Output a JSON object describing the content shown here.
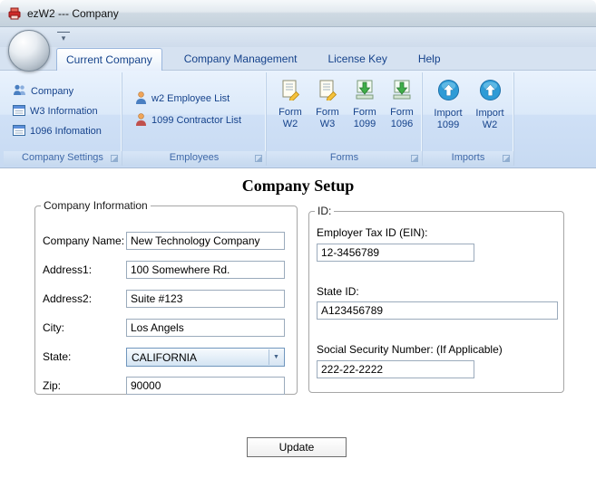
{
  "window": {
    "title": "ezW2 --- Company"
  },
  "icons": {
    "dropdown_arrow": "▾",
    "combo_arrow": "▼"
  },
  "colors": {
    "ribbon_text": "#15428b",
    "group_caption": "#3e68a8",
    "app_red": "#cf2a2a"
  },
  "ribbon": {
    "tabs": [
      {
        "label": "Current Company"
      },
      {
        "label": "Company Management"
      },
      {
        "label": "License Key"
      },
      {
        "label": "Help"
      }
    ],
    "company_settings": {
      "caption": "Company Settings",
      "items": [
        {
          "label": "Company"
        },
        {
          "label": "W3 Information"
        },
        {
          "label": "1096 Infomation"
        }
      ]
    },
    "employees": {
      "caption": "Employees",
      "items": [
        {
          "label": "w2 Employee List"
        },
        {
          "label": "1099 Contractor List"
        }
      ]
    },
    "forms": {
      "caption": "Forms",
      "items": [
        {
          "label": "Form\nW2"
        },
        {
          "label": "Form\nW3"
        },
        {
          "label": "Form\n1099"
        },
        {
          "label": "Form\n1096"
        }
      ]
    },
    "imports": {
      "caption": "Imports",
      "items": [
        {
          "label": "Import\n1099"
        },
        {
          "label": "Import\nW2"
        }
      ]
    }
  },
  "main": {
    "title": "Company Setup",
    "company_info": {
      "legend": "Company Information",
      "company_name": {
        "label": "Company Name:",
        "value": "New Technology Company"
      },
      "address1": {
        "label": "Address1:",
        "value": "100 Somewhere Rd."
      },
      "address2": {
        "label": "Address2:",
        "value": "Suite #123"
      },
      "city": {
        "label": "City:",
        "value": "Los Angels"
      },
      "state": {
        "label": "State:",
        "value": "CALIFORNIA"
      },
      "zip": {
        "label": "Zip:",
        "value": "90000"
      }
    },
    "ids": {
      "legend": "ID:",
      "ein": {
        "label": "Employer Tax ID (EIN):",
        "value": "12-3456789"
      },
      "state_id": {
        "label": "State ID:",
        "value": "A123456789"
      },
      "ssn": {
        "label": "Social Security Number: (If Applicable)",
        "value": "222-22-2222"
      }
    },
    "update_button": "Update"
  }
}
